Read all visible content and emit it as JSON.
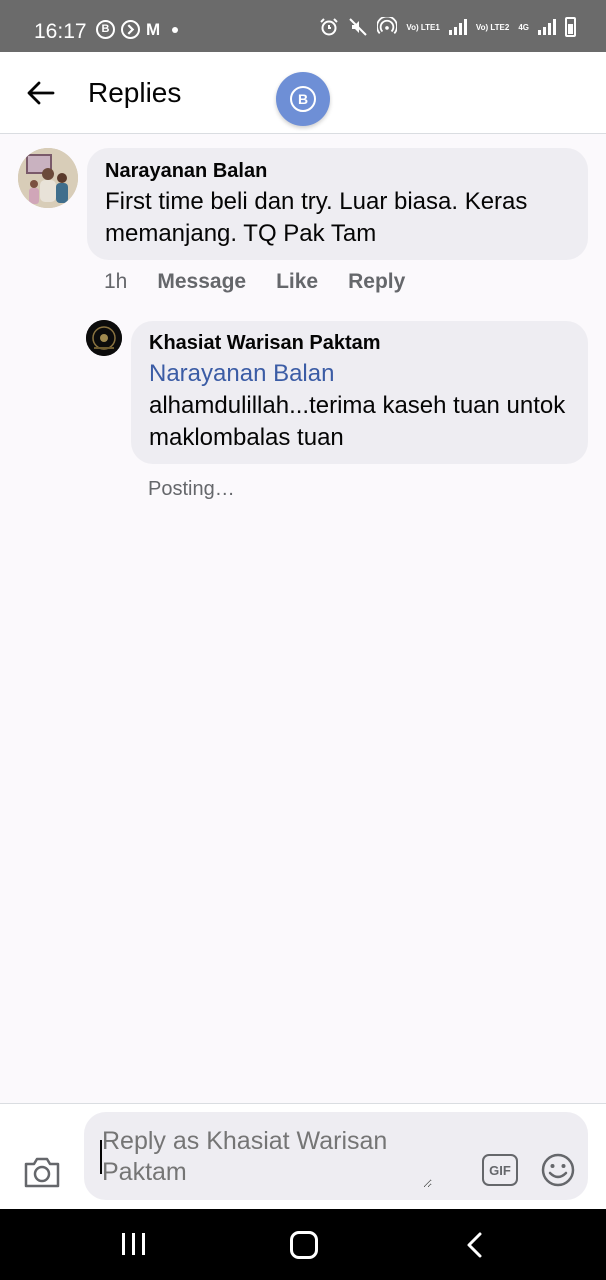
{
  "status_bar": {
    "time": "16:17",
    "left_icons": [
      "b-badge-icon",
      "forward-circle-icon",
      "gmail-icon",
      "notification-dot-icon"
    ],
    "right_icons": [
      "alarm-icon",
      "mute-icon",
      "hotspot-icon",
      "volte1-signal-icon",
      "volte2-signal-icon",
      "4g-signal-icon",
      "battery-icon"
    ],
    "badge_letter": "B",
    "mail_letter": "M",
    "volte1_label": "Vo) LTE1",
    "volte2_label": "Vo) LTE2",
    "net_label": "4G"
  },
  "header": {
    "title": "Replies",
    "back_icon": "arrow-left-icon",
    "floating_badge_letter": "B"
  },
  "comment": {
    "author": "Narayanan Balan",
    "text": "First time beli dan try. Luar biasa. Keras memanjang. TQ Pak Tam",
    "actions": {
      "time": "1h",
      "message": "Message",
      "like": "Like",
      "reply": "Reply"
    }
  },
  "reply": {
    "author": "Khasiat Warisan Paktam",
    "mention": "Narayanan Balan",
    "text": "alhamdulillah...terima kaseh tuan untok maklombalas tuan",
    "status": "Posting…"
  },
  "composer": {
    "placeholder": "Reply as Khasiat Warisan Paktam",
    "gif_label": "GIF",
    "camera_icon": "camera-icon",
    "emoji_icon": "smiley-icon"
  },
  "colors": {
    "status_bar": "#6b6b6b",
    "mention": "#3b5ca5",
    "bubble": "#eeedf2",
    "badge": "#6e8fd6",
    "secondary_text": "#65676b"
  }
}
